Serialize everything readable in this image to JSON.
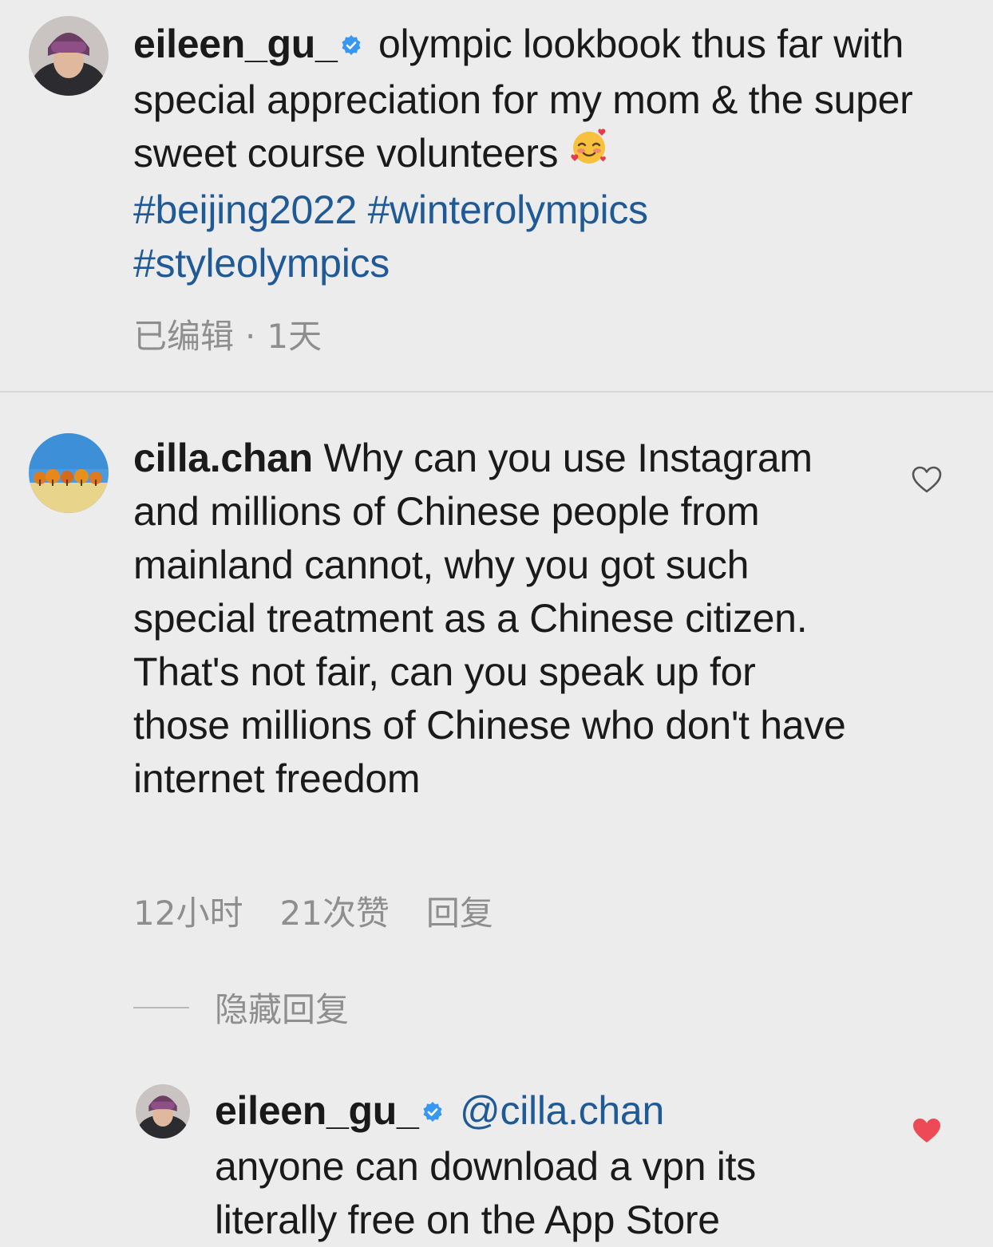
{
  "post": {
    "username": "eileen_gu_",
    "caption_text": "olympic lookbook thus far with special appreciation for my mom & the super sweet course volunteers",
    "emoji": "🥰",
    "hashtags": [
      "#beijing2022",
      "#winterolympics",
      "#styleolympics"
    ],
    "edited_label": "已编辑",
    "meta_separator": "·",
    "time": "1天"
  },
  "comment": {
    "username": "cilla.chan",
    "text": "Why can you use Instagram and millions of Chinese people from mainland cannot, why you got such special treatment as a Chinese citizen. That's not fair, can you speak up for those millions of Chinese who don't have internet freedom",
    "time": "12小时",
    "likes": "21次赞",
    "reply_label": "回复",
    "hide_replies_label": "隐藏回复",
    "like_icon": "heart-outline-icon"
  },
  "reply": {
    "username": "eileen_gu_",
    "mention": "@cilla.chan",
    "text": "anyone can download a vpn its literally free on the App Store",
    "like_icon": "heart-filled-icon",
    "liked": true
  },
  "colors": {
    "background": "#ececec",
    "hashtag": "#1f5a96",
    "verified": "#3897f0",
    "muted": "#8e8e8e",
    "liked_heart": "#ed4956"
  }
}
